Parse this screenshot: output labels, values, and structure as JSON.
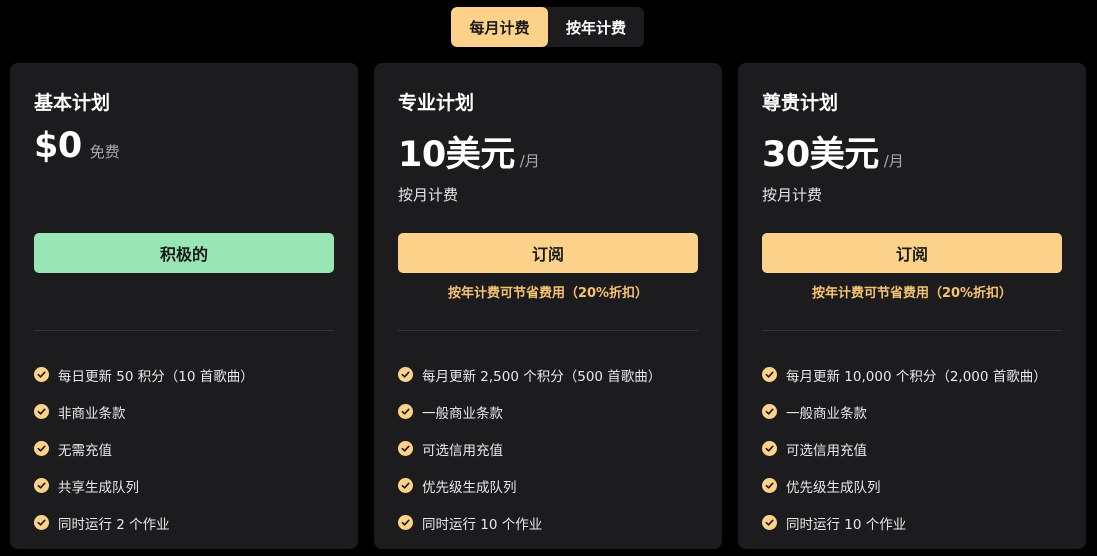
{
  "billing_toggle": {
    "monthly_label": "每月计费",
    "yearly_label": "按年计费"
  },
  "plans": [
    {
      "name": "基本计划",
      "price": "$0",
      "price_unit": "免费",
      "price_note": "",
      "cta_label": "积极的",
      "promo": "",
      "features": [
        "每日更新 50 积分（10 首歌曲）",
        "非商业条款",
        "无需充值",
        "共享生成队列",
        "同时运行 2 个作业"
      ]
    },
    {
      "name": "专业计划",
      "price": "10美元",
      "price_unit": "/月",
      "price_note": "按月计费",
      "cta_label": "订阅",
      "promo": "按年计费可节省费用（20%折扣）",
      "features": [
        "每月更新 2,500 个积分（500 首歌曲）",
        "一般商业条款",
        "可选信用充值",
        "优先级生成队列",
        "同时运行 10 个作业"
      ]
    },
    {
      "name": "尊贵计划",
      "price": "30美元",
      "price_unit": "/月",
      "price_note": "按月计费",
      "cta_label": "订阅",
      "promo": "按年计费可节省费用（20%折扣）",
      "features": [
        "每月更新 10,000 个积分（2,000 首歌曲）",
        "一般商业条款",
        "可选信用充值",
        "优先级生成队列",
        "同时运行 10 个作业"
      ]
    }
  ],
  "colors": {
    "accent_gold": "#fcd28a",
    "active_green": "#99e5b4",
    "promo_text": "#f5c372",
    "card_bg": "#1c1c1e"
  },
  "icons": {
    "feature_bullet": "check-circle-icon"
  }
}
